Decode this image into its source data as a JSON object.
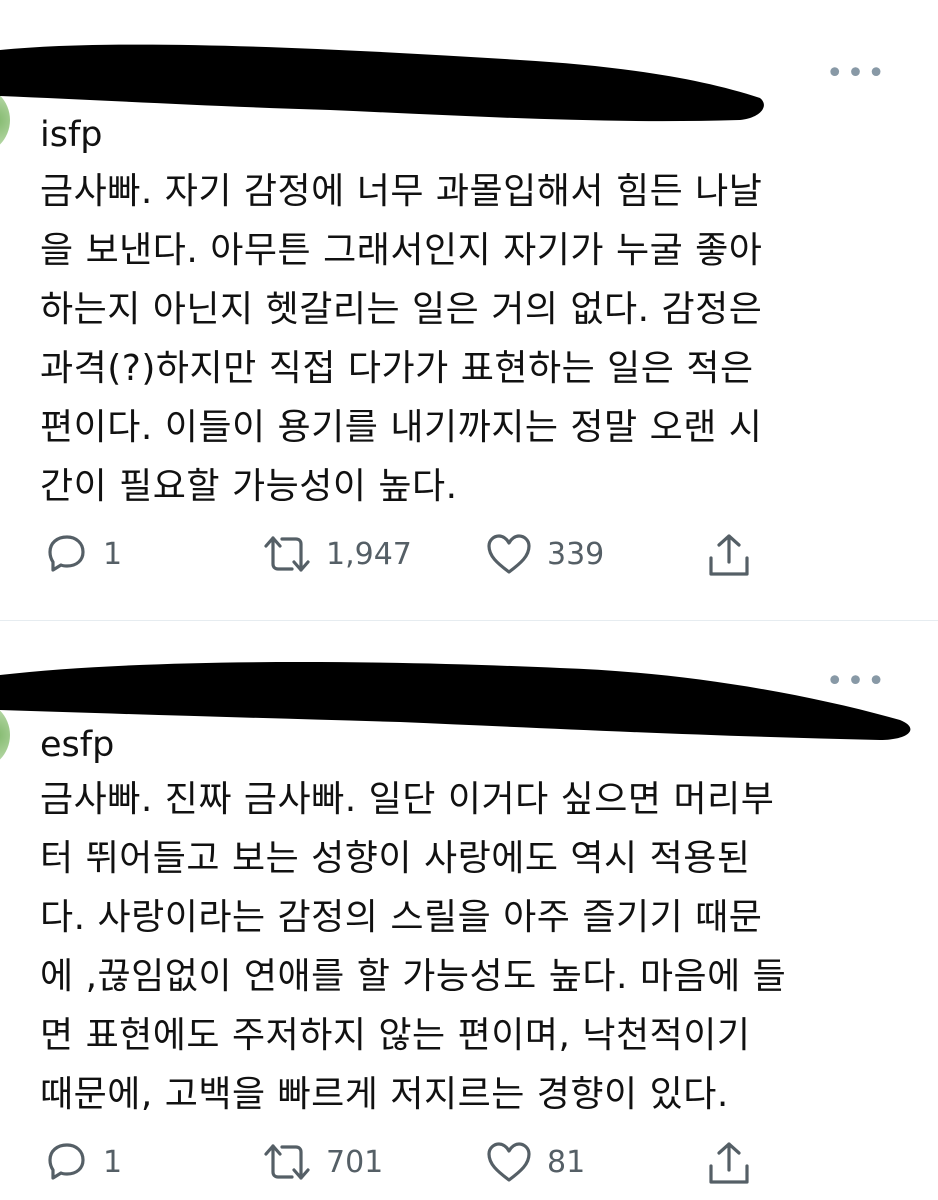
{
  "tweets": [
    {
      "handle": "isfp",
      "body_lines": [
        "금사빠. 자기 감정에 너무 과몰입해서 힘든 나날",
        "을 보낸다. 아무튼 그래서인지 자기가 누굴 좋아",
        "하는지 아닌지 헷갈리는 일은 거의 없다. 감정은",
        "과격(?)하지만 직접 다가가 표현하는 일은 적은",
        "편이다. 이들이 용기를 내기까지는 정말 오랜 시",
        "간이 필요할 가능성이 높다."
      ],
      "reply_count": "1",
      "retweet_count": "1,947",
      "like_count": "339",
      "icons": [
        "reply-icon",
        "retweet-icon",
        "like-icon",
        "share-icon"
      ]
    },
    {
      "handle": "esfp",
      "body_lines": [
        "금사빠. 진짜 금사빠. 일단 이거다 싶으면 머리부",
        "터 뛰어들고 보는 성향이 사랑에도 역시 적용된",
        "다. 사랑이라는 감정의 스릴을 아주 즐기기 때문",
        "에 ,끊임없이 연애를 할 가능성도 높다. 마음에 들",
        "면 표현에도 주저하지 않는 편이며, 낙천적이기",
        "때문에, 고백을 빠르게 저지르는 경향이 있다."
      ],
      "reply_count": "1",
      "retweet_count": "701",
      "like_count": "81",
      "icons": [
        "reply-icon",
        "retweet-icon",
        "like-icon",
        "share-icon"
      ]
    }
  ],
  "more_glyph": "•••",
  "colors": {
    "text": "#111111",
    "icon": "#555f66",
    "more": "#8899a6",
    "redaction": "#000000"
  }
}
